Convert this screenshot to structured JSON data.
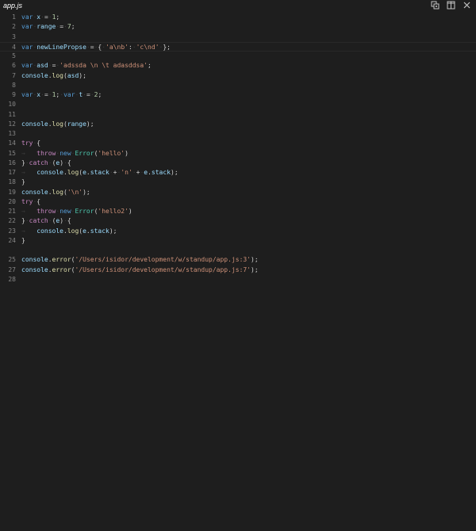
{
  "editor": {
    "tab_title": "app.js",
    "lines": [
      {
        "n": "1",
        "tokens": [
          [
            "kw",
            "var"
          ],
          [
            "ws",
            "·"
          ],
          [
            "var",
            "x"
          ],
          [
            "ws",
            "·"
          ],
          [
            "pl",
            "="
          ],
          [
            "ws",
            "·"
          ],
          [
            "num",
            "1"
          ],
          [
            "pl",
            ";"
          ]
        ]
      },
      {
        "n": "2",
        "tokens": [
          [
            "kw",
            "var"
          ],
          [
            "ws",
            "·"
          ],
          [
            "var",
            "range"
          ],
          [
            "ws",
            "·"
          ],
          [
            "pl",
            "="
          ],
          [
            "ws",
            "·"
          ],
          [
            "num",
            "7"
          ],
          [
            "pl",
            ";"
          ]
        ]
      },
      {
        "n": "3",
        "tokens": []
      },
      {
        "n": "4",
        "current": true,
        "tokens": [
          [
            "kw",
            "var"
          ],
          [
            "ws",
            "·"
          ],
          [
            "var",
            "newLinePropse"
          ],
          [
            "ws",
            "·"
          ],
          [
            "pl",
            "="
          ],
          [
            "ws",
            "·"
          ],
          [
            "pl",
            "{"
          ],
          [
            "ws",
            "·"
          ],
          [
            "str",
            "'a\\nb'"
          ],
          [
            "pl",
            ":"
          ],
          [
            "ws",
            "·"
          ],
          [
            "str",
            "'c\\nd'"
          ],
          [
            "ws",
            "·"
          ],
          [
            "pl",
            "};"
          ]
        ]
      },
      {
        "n": "5",
        "tokens": []
      },
      {
        "n": "6",
        "tokens": [
          [
            "kw",
            "var"
          ],
          [
            "ws",
            "·"
          ],
          [
            "var",
            "asd"
          ],
          [
            "ws",
            "·"
          ],
          [
            "pl",
            "="
          ],
          [
            "ws",
            "·"
          ],
          [
            "str",
            "'adssda \\n \\t adasddsa'"
          ],
          [
            "pl",
            ";"
          ]
        ]
      },
      {
        "n": "7",
        "tokens": [
          [
            "var",
            "console"
          ],
          [
            "pl",
            "."
          ],
          [
            "fn",
            "log"
          ],
          [
            "pl",
            "("
          ],
          [
            "var",
            "asd"
          ],
          [
            "pl",
            ");"
          ]
        ]
      },
      {
        "n": "8",
        "tokens": []
      },
      {
        "n": "9",
        "tokens": [
          [
            "kw",
            "var"
          ],
          [
            "ws",
            "·"
          ],
          [
            "var",
            "x"
          ],
          [
            "ws",
            "·"
          ],
          [
            "pl",
            "="
          ],
          [
            "ws",
            "·"
          ],
          [
            "num",
            "1"
          ],
          [
            "pl",
            ";"
          ],
          [
            "ws",
            "·"
          ],
          [
            "kw",
            "var"
          ],
          [
            "ws",
            "·"
          ],
          [
            "var",
            "t"
          ],
          [
            "ws",
            "·"
          ],
          [
            "pl",
            "="
          ],
          [
            "ws",
            "·"
          ],
          [
            "num",
            "2"
          ],
          [
            "pl",
            ";"
          ]
        ]
      },
      {
        "n": "10",
        "tokens": []
      },
      {
        "n": "11",
        "tokens": []
      },
      {
        "n": "12",
        "tokens": [
          [
            "var",
            "console"
          ],
          [
            "pl",
            "."
          ],
          [
            "fn",
            "log"
          ],
          [
            "pl",
            "("
          ],
          [
            "var",
            "range"
          ],
          [
            "pl",
            ");"
          ]
        ]
      },
      {
        "n": "13",
        "tokens": []
      },
      {
        "n": "14",
        "tokens": [
          [
            "kwc",
            "try"
          ],
          [
            "ws",
            "·"
          ],
          [
            "pl",
            "{"
          ]
        ]
      },
      {
        "n": "15",
        "tokens": [
          [
            "ws",
            "→   "
          ],
          [
            "kwc",
            "throw"
          ],
          [
            "ws",
            "·"
          ],
          [
            "kw",
            "new"
          ],
          [
            "ws",
            "·"
          ],
          [
            "cls",
            "Error"
          ],
          [
            "pl",
            "("
          ],
          [
            "str",
            "'hello'"
          ],
          [
            "pl",
            ")"
          ]
        ]
      },
      {
        "n": "16",
        "tokens": [
          [
            "pl",
            "}"
          ],
          [
            "ws",
            "·"
          ],
          [
            "kwc",
            "catch"
          ],
          [
            "ws",
            "·"
          ],
          [
            "pl",
            "("
          ],
          [
            "var",
            "e"
          ],
          [
            "pl",
            ")"
          ],
          [
            "ws",
            "·"
          ],
          [
            "pl",
            "{"
          ]
        ]
      },
      {
        "n": "17",
        "tokens": [
          [
            "ws",
            "→   "
          ],
          [
            "var",
            "console"
          ],
          [
            "pl",
            "."
          ],
          [
            "fn",
            "log"
          ],
          [
            "pl",
            "("
          ],
          [
            "var",
            "e"
          ],
          [
            "pl",
            "."
          ],
          [
            "var",
            "stack"
          ],
          [
            "ws",
            "·"
          ],
          [
            "pl",
            "+"
          ],
          [
            "ws",
            "·"
          ],
          [
            "str",
            "'n'"
          ],
          [
            "ws",
            "·"
          ],
          [
            "pl",
            "+"
          ],
          [
            "ws",
            "·"
          ],
          [
            "var",
            "e"
          ],
          [
            "pl",
            "."
          ],
          [
            "var",
            "stack"
          ],
          [
            "pl",
            ");"
          ]
        ]
      },
      {
        "n": "18",
        "tokens": [
          [
            "pl",
            "}"
          ]
        ]
      },
      {
        "n": "19",
        "tokens": [
          [
            "var",
            "console"
          ],
          [
            "pl",
            "."
          ],
          [
            "fn",
            "log"
          ],
          [
            "pl",
            "("
          ],
          [
            "str",
            "'\\n'"
          ],
          [
            "pl",
            ");"
          ]
        ]
      },
      {
        "n": "20",
        "tokens": [
          [
            "kwc",
            "try"
          ],
          [
            "ws",
            "·"
          ],
          [
            "pl",
            "{"
          ]
        ]
      },
      {
        "n": "21",
        "tokens": [
          [
            "ws",
            "→   "
          ],
          [
            "kwc",
            "throw"
          ],
          [
            "ws",
            "·"
          ],
          [
            "kw",
            "new"
          ],
          [
            "ws",
            "·"
          ],
          [
            "cls",
            "Error"
          ],
          [
            "pl",
            "("
          ],
          [
            "str",
            "'hello2'"
          ],
          [
            "pl",
            ")"
          ]
        ]
      },
      {
        "n": "22",
        "tokens": [
          [
            "pl",
            "}"
          ],
          [
            "ws",
            "·"
          ],
          [
            "kwc",
            "catch"
          ],
          [
            "ws",
            "·"
          ],
          [
            "pl",
            "("
          ],
          [
            "var",
            "e"
          ],
          [
            "pl",
            ")"
          ],
          [
            "ws",
            "·"
          ],
          [
            "pl",
            "{"
          ]
        ]
      },
      {
        "n": "23",
        "tokens": [
          [
            "ws",
            "→   "
          ],
          [
            "var",
            "console"
          ],
          [
            "pl",
            "."
          ],
          [
            "fn",
            "log"
          ],
          [
            "pl",
            "("
          ],
          [
            "var",
            "e"
          ],
          [
            "pl",
            "."
          ],
          [
            "var",
            "stack"
          ],
          [
            "pl",
            ");"
          ]
        ]
      },
      {
        "n": "24",
        "tokens": [
          [
            "pl",
            "}"
          ]
        ]
      },
      {
        "n": "",
        "tokens": []
      },
      {
        "n": "25",
        "tokens": [
          [
            "var",
            "console"
          ],
          [
            "pl",
            "."
          ],
          [
            "fn",
            "error"
          ],
          [
            "pl",
            "("
          ],
          [
            "str",
            "'/Users/isidor/development/w/standup/app.js:3'"
          ],
          [
            "pl",
            ");"
          ]
        ]
      },
      {
        "n": "27",
        "tokens": [
          [
            "var",
            "console"
          ],
          [
            "pl",
            "."
          ],
          [
            "fn",
            "error"
          ],
          [
            "pl",
            "("
          ],
          [
            "str",
            "'/Users/isidor/development/w/standup/app.js:7'"
          ],
          [
            "pl",
            ");"
          ]
        ]
      },
      {
        "n": "28",
        "tokens": []
      }
    ]
  },
  "actions": [
    {
      "name": "open-changes-icon"
    },
    {
      "name": "split-editor-icon"
    },
    {
      "name": "close-icon"
    }
  ],
  "colors": {
    "background": "#1e1e1e",
    "keyword": "#569cd6",
    "control": "#c586c0",
    "variable": "#9cdcfe",
    "number": "#b5cea8",
    "string": "#ce9178",
    "function": "#dcdcaa",
    "class": "#4ec9b0",
    "line_number": "#858585"
  }
}
